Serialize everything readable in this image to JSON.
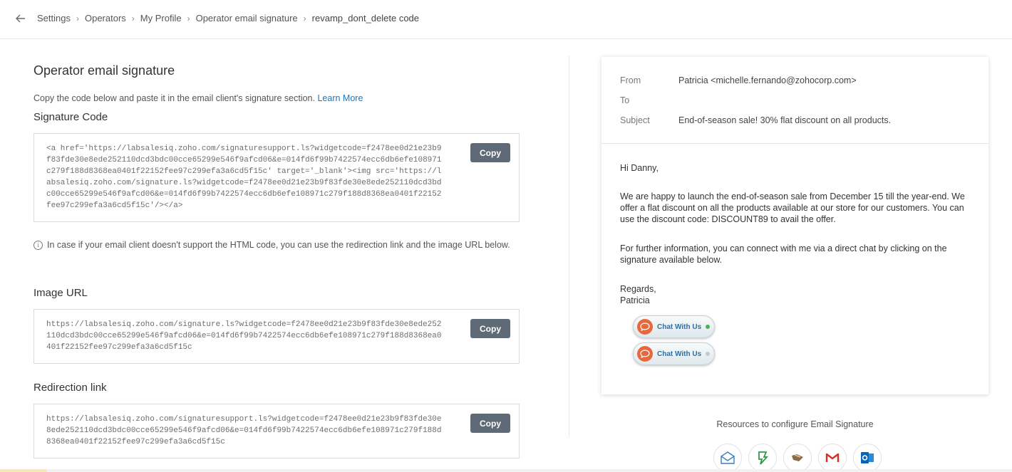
{
  "header": {
    "breadcrumbs": [
      "Settings",
      "Operators",
      "My Profile",
      "Operator email signature",
      "revamp_dont_delete code"
    ]
  },
  "main": {
    "title": "Operator email signature",
    "intro_text": "Copy the code below and paste it in the email client's signature section.",
    "learn_more": "Learn More",
    "signature_code": {
      "label": "Signature Code",
      "code": "<a href='https://labsalesiq.zoho.com/signaturesupport.ls?widgetcode=f2478ee0d21e23b9\nf83fde30e8ede252110dcd3bdc00cce65299e546f9afcd06&e=014fd6f99b7422574ecc6db6efe108971\nc279f188d8368ea0401f22152fee97c299efa3a6cd5f15c' target='_blank'><img src='https://l\nabsalesiq.zoho.com/signature.ls?widgetcode=f2478ee0d21e23b9f83fde30e8ede252110dcd3bd\nc00cce65299e546f9afcd06&e=014fd6f99b7422574ecc6db6efe108971c279f188d8368ea0401f22152\nfee97c299efa3a6cd5f15c'/></a>",
      "copy_label": "Copy"
    },
    "info_text": "In case if your email client doesn't support the HTML code, you can use the redirection link and the image URL below.",
    "image_url": {
      "label": "Image URL",
      "code": "https://labsalesiq.zoho.com/signature.ls?widgetcode=f2478ee0d21e23b9f83fde30e8ede252\n110dcd3bdc00cce65299e546f9afcd06&e=014fd6f99b7422574ecc6db6efe108971c279f188d8368ea0\n401f22152fee97c299efa3a6cd5f15c",
      "copy_label": "Copy"
    },
    "redirection_link": {
      "label": "Redirection link",
      "code": "https://labsalesiq.zoho.com/signaturesupport.ls?widgetcode=f2478ee0d21e23b9f83fde30e\n8ede252110dcd3bdc00cce65299e546f9afcd06&e=014fd6f99b7422574ecc6db6efe108971c279f188d\n8368ea0401f22152fee97c299efa3a6cd5f15c",
      "copy_label": "Copy"
    }
  },
  "preview": {
    "from_label": "From",
    "from_value": "Patricia <michelle.fernando@zohocorp.com>",
    "to_label": "To",
    "to_value": "",
    "subject_label": "Subject",
    "subject_value": "End-of-season sale! 30% flat discount on all products.",
    "greeting": "Hi Danny,",
    "paragraph1": "We are happy to launch the end-of-season sale from December 15 till the year-end. We offer a flat discount on all the products available at our store for our customers. You can use the discount code: DISCOUNT89 to avail the offer.",
    "paragraph2": "For further information, you can connect with me via a direct chat by clicking on the signature available below.",
    "regards": "Regards,",
    "signer": "Patricia",
    "badges": [
      {
        "label": "Chat With Us",
        "status": "online",
        "status_color": "#4caf50"
      },
      {
        "label": "Chat With Us",
        "status": "offline",
        "status_color": "#c8c8c8"
      }
    ]
  },
  "resources": {
    "title": "Resources to configure Email Signature",
    "icons": [
      "mail-icon",
      "evernote-style-icon",
      "mail-client-icon",
      "gmail-icon",
      "outlook-icon"
    ]
  },
  "colors": {
    "accent_link": "#1a78c2",
    "copy_button": "#5e6a76",
    "chat_badge": "#e8683d"
  }
}
